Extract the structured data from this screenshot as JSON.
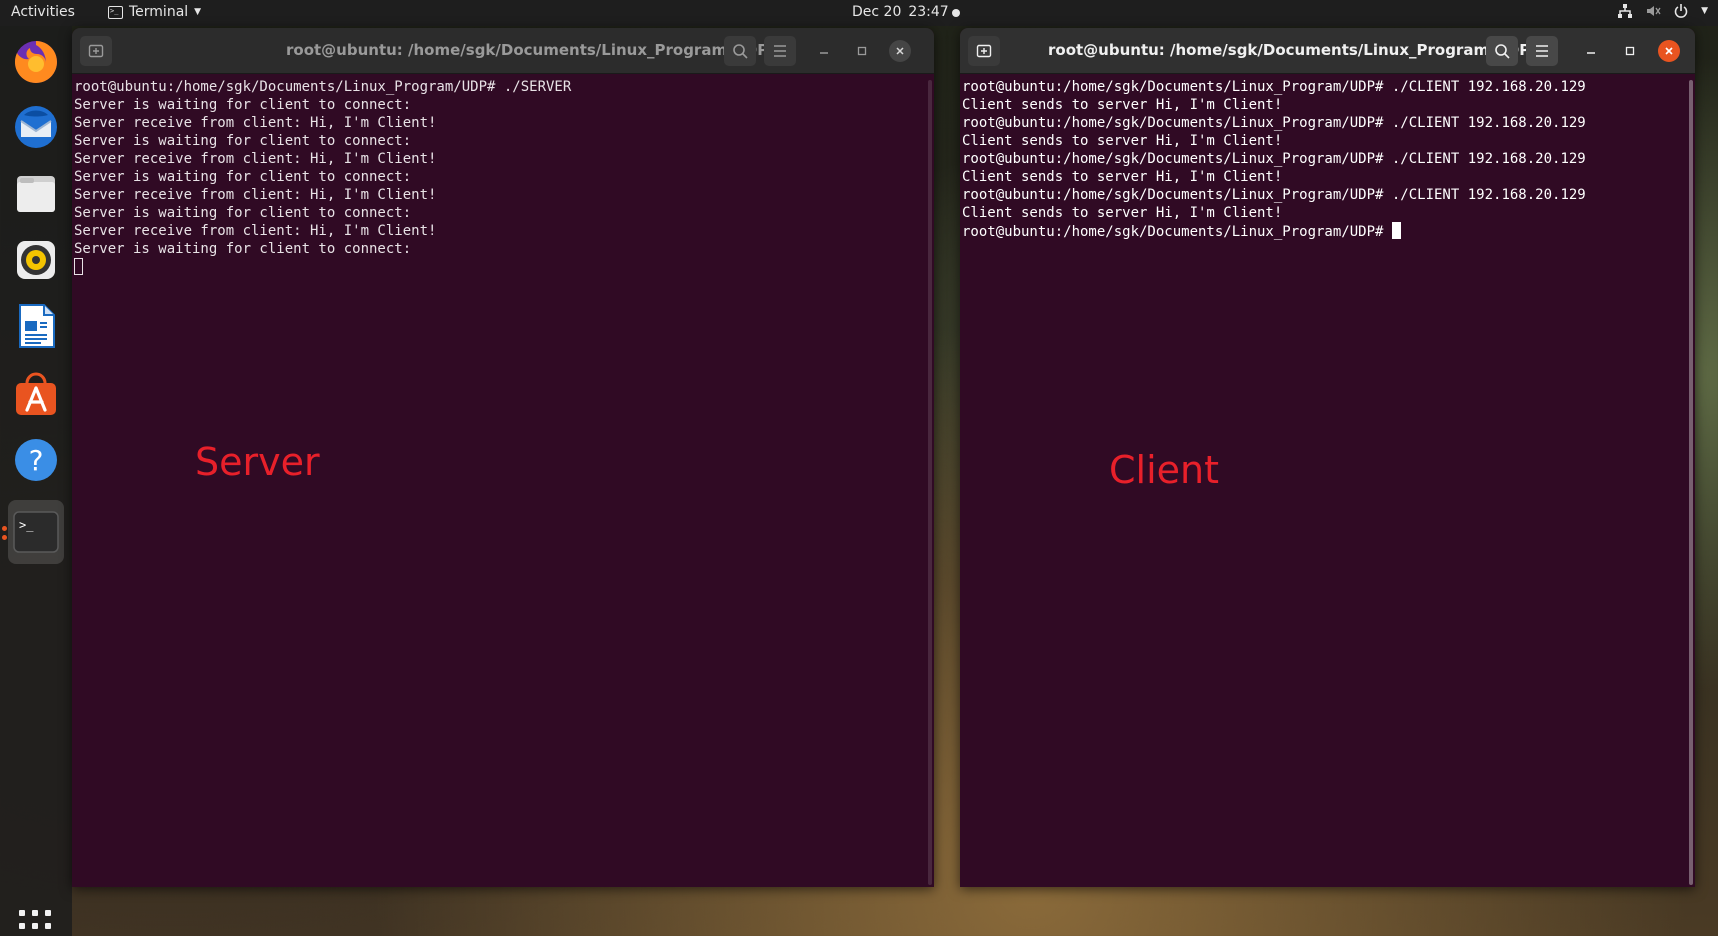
{
  "topbar": {
    "activities": "Activities",
    "app_name": "Terminal",
    "date": "Dec 20",
    "time": "23:47",
    "icons": [
      "network-icon",
      "volume-muted-icon",
      "power-icon",
      "system-menu-caret-icon"
    ]
  },
  "dock": {
    "items": [
      "firefox-icon",
      "thunderbird-icon",
      "files-icon",
      "rhythmbox-icon",
      "libreoffice-writer-icon",
      "ubuntu-software-icon",
      "help-icon",
      "terminal-icon"
    ],
    "apps_grid": "show-applications-icon"
  },
  "colors": {
    "terminal_bg": "#300a24",
    "accent_orange": "#e95420",
    "annotation_red": "#e8202a"
  },
  "server": {
    "title": "root@ubuntu: /home/sgk/Documents/Linux_Program/UDP",
    "lines": [
      "root@ubuntu:/home/sgk/Documents/Linux_Program/UDP# ./SERVER",
      "Server is waiting for client to connect:",
      "Server receive from client: Hi, I'm Client!",
      "Server is waiting for client to connect:",
      "Server receive from client: Hi, I'm Client!",
      "Server is waiting for client to connect:",
      "Server receive from client: Hi, I'm Client!",
      "Server is waiting for client to connect:",
      "Server receive from client: Hi, I'm Client!",
      "Server is waiting for client to connect:"
    ],
    "annotation": "Server"
  },
  "client": {
    "title": "root@ubuntu: /home/sgk/Documents/Linux_Program/UDP",
    "lines": [
      "root@ubuntu:/home/sgk/Documents/Linux_Program/UDP# ./CLIENT 192.168.20.129",
      "Client sends to server Hi, I'm Client!",
      "root@ubuntu:/home/sgk/Documents/Linux_Program/UDP# ./CLIENT 192.168.20.129",
      "Client sends to server Hi, I'm Client!",
      "root@ubuntu:/home/sgk/Documents/Linux_Program/UDP# ./CLIENT 192.168.20.129",
      "Client sends to server Hi, I'm Client!",
      "root@ubuntu:/home/sgk/Documents/Linux_Program/UDP# ./CLIENT 192.168.20.129",
      "Client sends to server Hi, I'm Client!"
    ],
    "prompt": "root@ubuntu:/home/sgk/Documents/Linux_Program/UDP# ",
    "annotation": "Client"
  }
}
